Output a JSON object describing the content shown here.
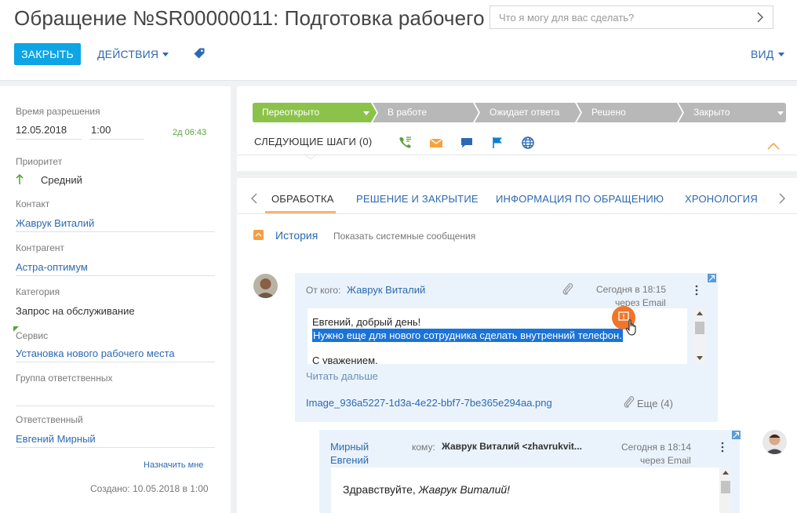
{
  "header": {
    "title": "Обращение №SR00000011: Подготовка рабочего ...",
    "search_placeholder": "Что я могу для вас сделать?",
    "close_label": "Закрыть",
    "actions_label": "Действия",
    "view_label": "Вид"
  },
  "left_panel": {
    "resolution_label": "Время разрешения",
    "resolution_date": "12.05.2018",
    "resolution_time": "1:00",
    "remaining": "2д 06:43",
    "priority_label": "Приоритет",
    "priority_value": "Средний",
    "contact_label": "Контакт",
    "contact_value": "Жаврук Виталий",
    "account_label": "Контрагент",
    "account_value": "Астра-оптимум",
    "category_label": "Категория",
    "category_value": "Запрос на обслуживание",
    "service_label": "Сервис",
    "service_value": "Установка нового рабочего места",
    "group_label": "Группа ответственных",
    "assignee_label": "Ответственный",
    "assignee_value": "Евгений Мирный",
    "assign_me": "Назначить мне",
    "created": "Создано: 10.05.2018 в 1:00"
  },
  "stages": {
    "items": [
      "Переоткрыто",
      "В работе",
      "Ожидает ответа",
      "Решено",
      "Закрыто"
    ],
    "active_color": "#8bc34a",
    "inactive_color": "#b8b8b8"
  },
  "next_steps": {
    "label": "Следующие шаги (0)",
    "icons": [
      "phone-icon",
      "email-icon",
      "chat-icon",
      "flag-icon",
      "globe-icon"
    ]
  },
  "tabs": [
    "Обработка",
    "Решение и закрытие",
    "Информация по обращению",
    "Хронология"
  ],
  "history": {
    "title": "История",
    "system_messages": "Показать системные сообщения"
  },
  "message1": {
    "from_label": "От кого:",
    "from_name": "Жаврук Виталий",
    "date": "Сегодня в 18:15",
    "via": "через Email",
    "line1": "Евгений, добрый день!",
    "line2": "Нужно еще для нового сотрудника сделать внутренний телефон.",
    "line3": "С уважением,",
    "read_more": "Читать дальше",
    "attachment": "Image_936a5227-1d3a-4e22-bbf7-7be365e294aa.png",
    "more_attachments": "Еще (4)"
  },
  "message2": {
    "from_first": "Мирный",
    "from_second": "Евгений",
    "to_label": "кому:",
    "to_value": "Жаврук Виталий <zhavrukvit...",
    "date": "Сегодня в 18:14",
    "via": "через Email",
    "greeting": "Здравствуйте,",
    "greeting_name": "Жаврук Виталий!"
  },
  "colors": {
    "accent": "#0da5e5",
    "link": "#2c69b1",
    "stage_active": "#8bc34a",
    "stage_inactive": "#b8b8b8",
    "badge": "#f0752b",
    "selection": "#1a73d9"
  }
}
